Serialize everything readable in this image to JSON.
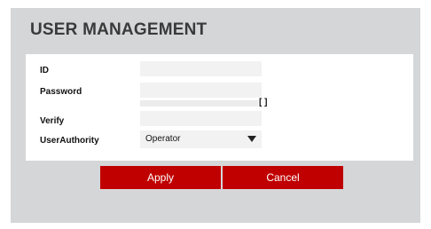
{
  "page": {
    "title": "USER MANAGEMENT"
  },
  "form": {
    "id_label": "ID",
    "id_value": "",
    "password_label": "Password",
    "password_value": "",
    "strength_indicator": "[ ]",
    "verify_label": "Verify",
    "verify_value": "",
    "authority_label": "UserAuthority",
    "authority_value": "Operator"
  },
  "actions": {
    "apply_label": "Apply",
    "cancel_label": "Cancel"
  },
  "colors": {
    "panel_bg": "#d5d6d8",
    "button_bg": "#c00000",
    "title_text": "#3a3a3a"
  }
}
